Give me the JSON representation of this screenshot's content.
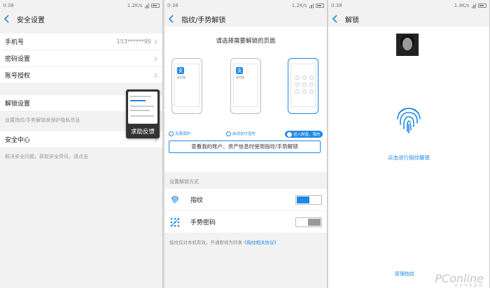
{
  "status": {
    "time": "0:38",
    "speed_left": "1.2K/s",
    "speed_right": "1.4K/s"
  },
  "screen1": {
    "title": "安全设置",
    "rows": [
      {
        "label": "手机号",
        "value": "153******95"
      },
      {
        "label": "密码设置",
        "value": ""
      },
      {
        "label": "账号授权",
        "value": ""
      }
    ],
    "unlock_label": "解锁设置",
    "unlock_hint": "设置指纹/手势解锁来保护隐私信息",
    "security_center": "安全中心",
    "security_hint": "解决安全问题，获取安全资讯，请点击",
    "feedback_label": "求助反馈"
  },
  "screen2": {
    "title": "指纹/手势解锁",
    "prompt": "请选择需要解锁的页面",
    "app_icon": "支",
    "app_name": "支付宝",
    "options": [
      "无需保护",
      "启动支付宝时",
      "进入财富，我的"
    ],
    "view_button": "查看我的账户、资产信息时使用指纹/手势解锁",
    "section_label": "设置解锁方式",
    "methods": [
      {
        "label": "指纹",
        "icon": "fingerprint-icon",
        "enabled": true
      },
      {
        "label": "手势密码",
        "icon": "gesture-icon",
        "enabled": false
      }
    ],
    "footer_text": "指纹仅对本机有效，开通即视为同意",
    "footer_link": "《指纹相关协议》"
  },
  "screen3": {
    "title": "解锁",
    "action": "点击进行指纹解锁",
    "manage": "管理指纹"
  },
  "watermark": {
    "brand": "PConline",
    "sub": "太平洋电脑网"
  },
  "colors": {
    "accent": "#1e88e5",
    "text": "#222222",
    "muted": "#888888"
  }
}
